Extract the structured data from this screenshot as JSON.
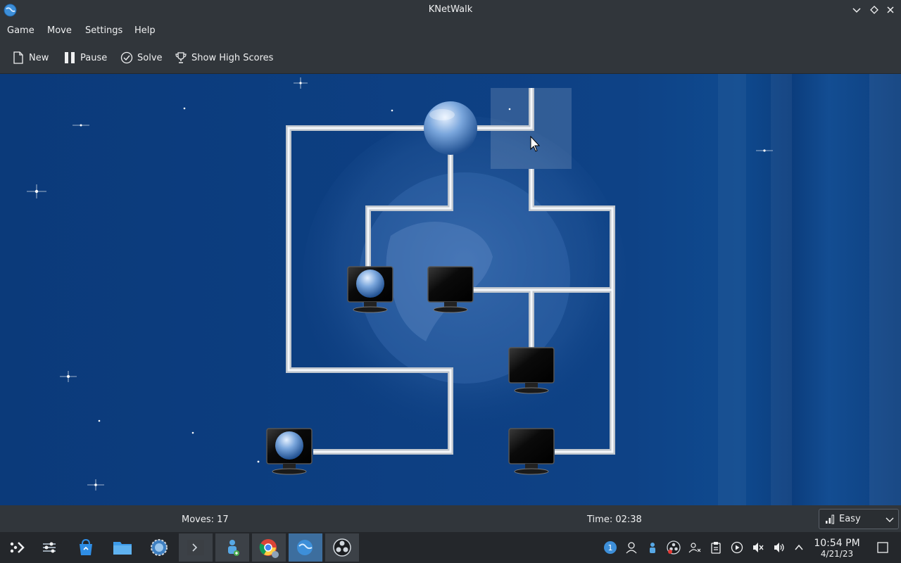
{
  "window": {
    "title": "KNetWalk"
  },
  "menu": {
    "game": "Game",
    "move": "Move",
    "settings": "Settings",
    "help": "Help"
  },
  "toolbar": {
    "new_label": "New",
    "pause_label": "Pause",
    "solve_label": "Solve",
    "highscores_label": "Show High Scores"
  },
  "status": {
    "moves": "Moves: 17",
    "time": "Time: 02:38"
  },
  "difficulty": {
    "selected": "Easy"
  },
  "clock": {
    "time": "10:54 PM",
    "date": "4/21/23"
  },
  "colors": {
    "chrome": "#31363b",
    "board_blue": "#0d3f82",
    "pipe": "#e8ecf0",
    "taskbar": "#24272b"
  },
  "taskbar": {
    "launchers": [
      "app-launcher-icon",
      "system-settings-icon",
      "discover-icon",
      "file-manager-icon",
      "steam-icon",
      "konsole-icon",
      "user-manager-icon",
      "chrome-icon",
      "knetwalk-icon",
      "obs-icon"
    ]
  }
}
